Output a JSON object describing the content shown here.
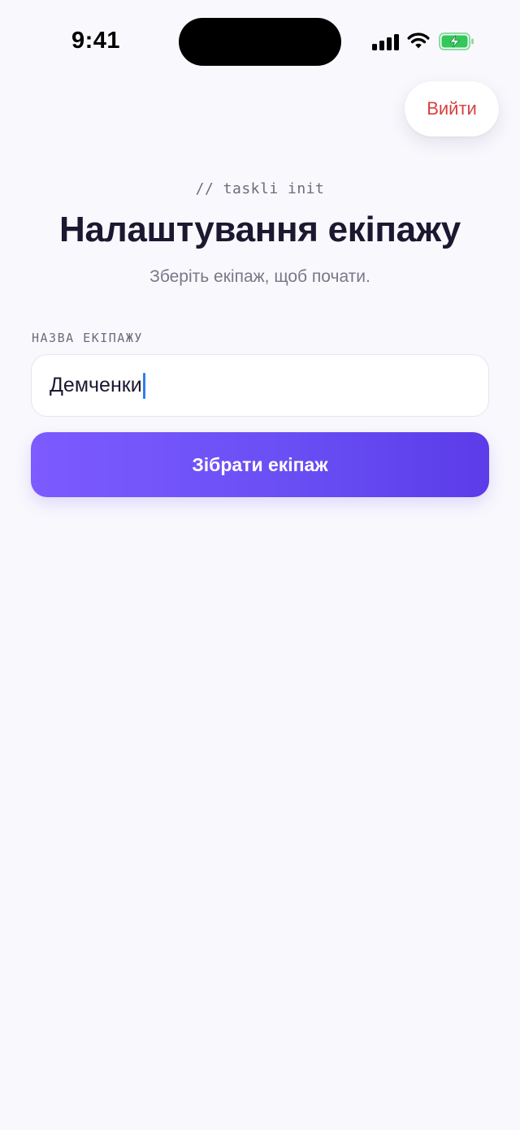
{
  "status_bar": {
    "time": "9:41",
    "signal_icon": "cellular-signal-icon",
    "wifi_icon": "wifi-icon",
    "battery_icon": "battery-charging-icon",
    "battery_color": "#34c759"
  },
  "header": {
    "logout_label": "Вийти",
    "logout_color": "#d94040",
    "eyebrow": "// taskli init",
    "title": "Налаштування екіпажу",
    "subtitle": "Зберіть екіпаж, щоб почати."
  },
  "form": {
    "crew_name_label": "НАЗВА ЕКІПАЖУ",
    "crew_name_value": "Демченки",
    "submit_label": "Зібрати екіпаж",
    "accent_color": "#6a4ff5"
  }
}
